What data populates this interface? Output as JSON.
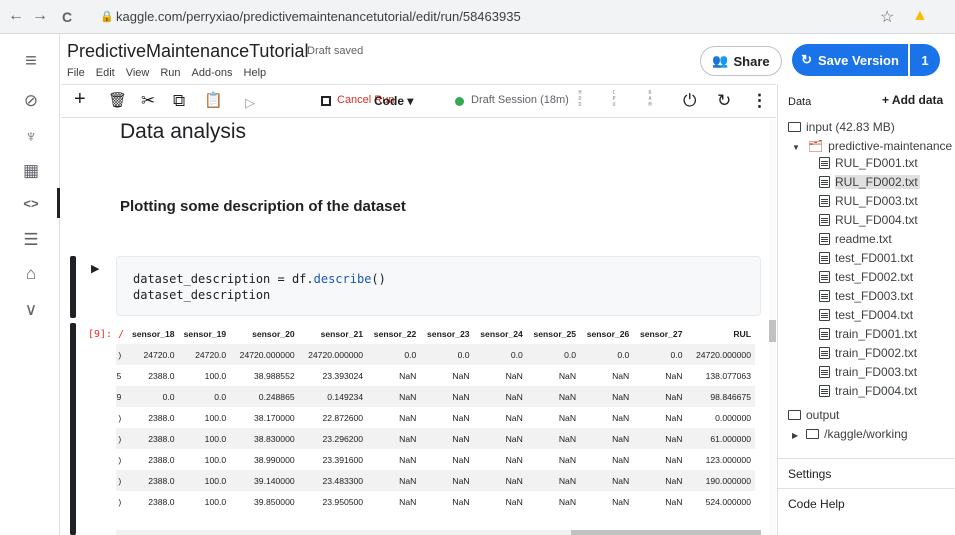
{
  "browser": {
    "url": "kaggle.com/perryxiao/predictivemaintenancetutorial/edit/run/58463935",
    "back_glyph": "←",
    "forward_glyph": "→",
    "reload_glyph": "C",
    "star_glyph": "☆",
    "extension_glyph": "▲"
  },
  "rail": {
    "icons": [
      "menu-icon",
      "compass-icon",
      "trophy-icon",
      "table-icon",
      "code-icon",
      "comment-icon",
      "graduation-cap-icon",
      "chevron-down-icon"
    ],
    "glyphs": {
      "menu": "≡",
      "compass": "⊘",
      "trophy": "♆",
      "table": "▦",
      "code": "<>",
      "comment": "☰",
      "learn": "⌂",
      "more": "∨"
    }
  },
  "header": {
    "title": "PredictiveMaintenanceTutorial",
    "status": "Draft saved",
    "menu": [
      "File",
      "Edit",
      "View",
      "Run",
      "Add-ons",
      "Help"
    ],
    "share_label": "Share",
    "save_label": "Save Version",
    "version_count": "1"
  },
  "toolbar": {
    "glyphs": {
      "add": "+",
      "delete": "🗑",
      "cut": "✂",
      "copy": "⧉",
      "paste": "📋",
      "run": "▷",
      "power": "⏻",
      "refresh": "↻",
      "more": "⋮"
    },
    "cancel_run": "Cancel Run",
    "cell_type": "Code ▾",
    "session": "Draft Session (18m)",
    "meters": [
      "H D D",
      "C P U",
      "R A M"
    ]
  },
  "notebook": {
    "heading1": "Data analysis",
    "heading2": "Plotting some description of the dataset",
    "run_glyph": "▶",
    "code_line1_a": "dataset_description = df.",
    "code_line1_fn": "describe",
    "code_line1_b": "()",
    "code_line2": "dataset_description",
    "output_prompt": "[9]: /",
    "table": {
      "columns": [
        "",
        "sensor_18",
        "sensor_19",
        "sensor_20",
        "sensor_21",
        "sensor_22",
        "sensor_23",
        "sensor_24",
        "sensor_25",
        "sensor_26",
        "sensor_27",
        "RUL"
      ],
      "rows": [
        [
          ")",
          "24720.0",
          "24720.0",
          "24720.000000",
          "24720.000000",
          "0.0",
          "0.0",
          "0.0",
          "0.0",
          "0.0",
          "0.0",
          "24720.000000"
        ],
        [
          "5",
          "2388.0",
          "100.0",
          "38.988552",
          "23.393024",
          "NaN",
          "NaN",
          "NaN",
          "NaN",
          "NaN",
          "NaN",
          "138.077063"
        ],
        [
          "9",
          "0.0",
          "0.0",
          "0.248865",
          "0.149234",
          "NaN",
          "NaN",
          "NaN",
          "NaN",
          "NaN",
          "NaN",
          "98.846675"
        ],
        [
          ")",
          "2388.0",
          "100.0",
          "38.170000",
          "22.872600",
          "NaN",
          "NaN",
          "NaN",
          "NaN",
          "NaN",
          "NaN",
          "0.000000"
        ],
        [
          ")",
          "2388.0",
          "100.0",
          "38.830000",
          "23.296200",
          "NaN",
          "NaN",
          "NaN",
          "NaN",
          "NaN",
          "NaN",
          "61.000000"
        ],
        [
          ")",
          "2388.0",
          "100.0",
          "38.990000",
          "23.391600",
          "NaN",
          "NaN",
          "NaN",
          "NaN",
          "NaN",
          "NaN",
          "123.000000"
        ],
        [
          ")",
          "2388.0",
          "100.0",
          "39.140000",
          "23.483300",
          "NaN",
          "NaN",
          "NaN",
          "NaN",
          "NaN",
          "NaN",
          "190.000000"
        ],
        [
          ")",
          "2388.0",
          "100.0",
          "39.850000",
          "23.950500",
          "NaN",
          "NaN",
          "NaN",
          "NaN",
          "NaN",
          "NaN",
          "524.000000"
        ]
      ]
    }
  },
  "panel": {
    "data_label": "Data",
    "add_data": "+ Add data",
    "input_folder": "input (42.83 MB)",
    "dataset": "predictive-maintenance",
    "files": [
      "RUL_FD001.txt",
      "RUL_FD002.txt",
      "RUL_FD003.txt",
      "RUL_FD004.txt",
      "readme.txt",
      "test_FD001.txt",
      "test_FD002.txt",
      "test_FD003.txt",
      "test_FD004.txt",
      "train_FD001.txt",
      "train_FD002.txt",
      "train_FD003.txt",
      "train_FD004.txt"
    ],
    "selected_file": "RUL_FD002.txt",
    "output_folder": "output",
    "working_folder": "/kaggle/working",
    "settings": "Settings",
    "code_help": "Code Help"
  }
}
